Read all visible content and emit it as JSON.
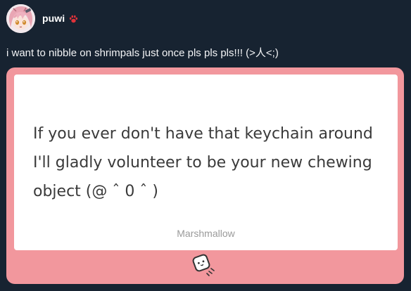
{
  "post": {
    "username": "puwi",
    "text": "i want to nibble on shrimpals just once pls pls pls!!! (>人<;)",
    "icons": {
      "avatar": "anime-girl-avatar",
      "badge": "paw-icon"
    }
  },
  "card": {
    "message": "If you ever don't have that keychain around I'll gladly volunteer to be your new chewing object (@ ˆ 0 ˆ )",
    "brand": "Marshmallow",
    "icon": "marshmallow-icon"
  },
  "colors": {
    "background": "#172331",
    "card_pink": "#f2979d",
    "card_white": "#ffffff",
    "paw_red": "#e0323a"
  }
}
